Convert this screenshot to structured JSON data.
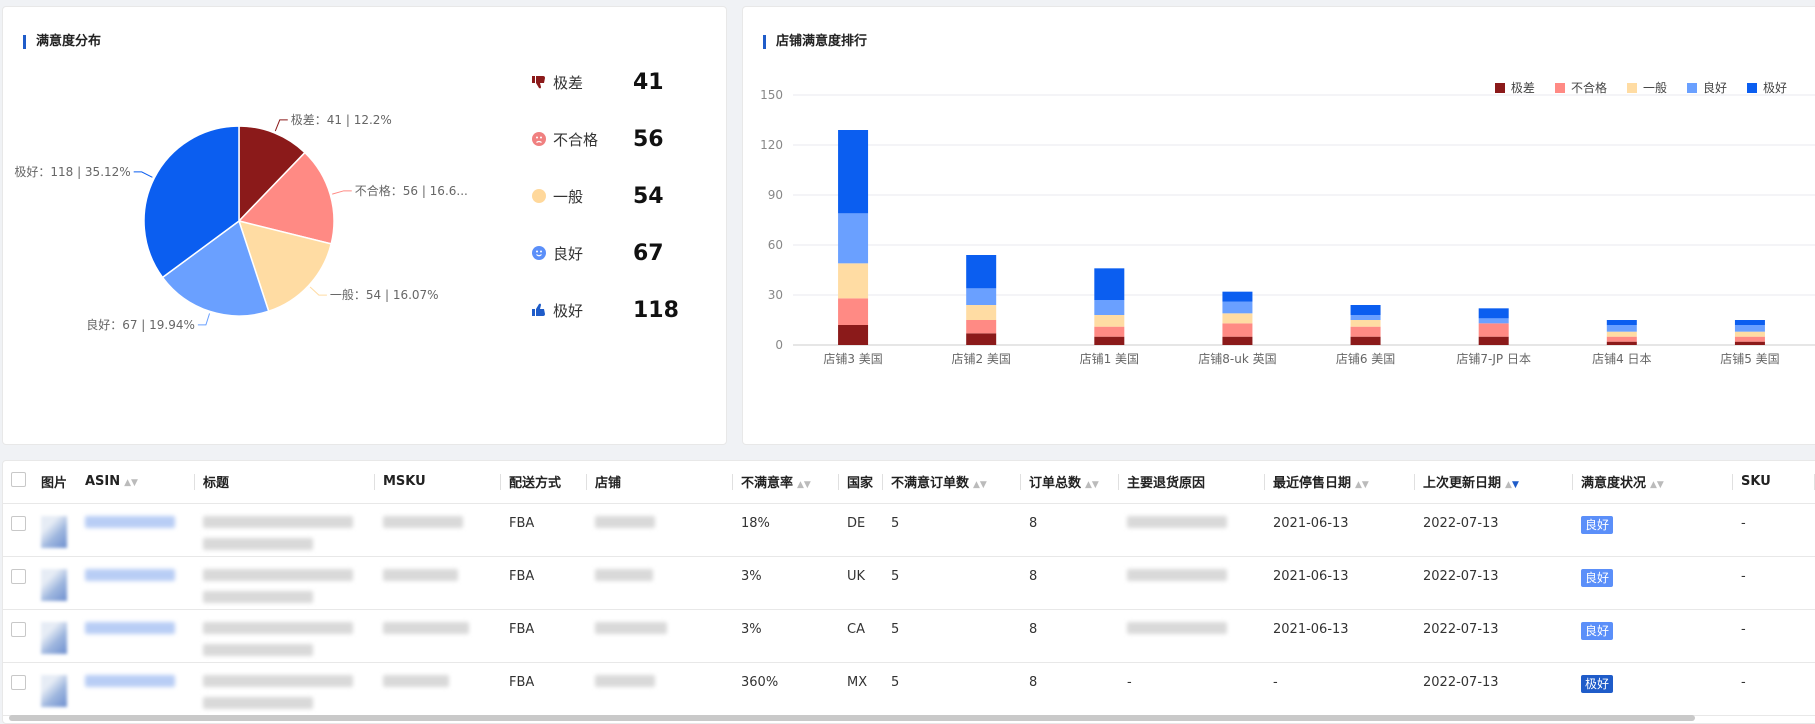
{
  "pie_panel": {
    "title": "满意度分布",
    "icon_colors": {
      "bad": "#8b1a1a",
      "neutral": "#f08080",
      "normal": "#ffd89b",
      "good": "#5b8ff9",
      "best": "#1f5cc9"
    },
    "legend": [
      {
        "label": "极差",
        "value": "41",
        "icon": "thumbs-down-icon",
        "color": "#8b1a1a"
      },
      {
        "label": "不合格",
        "value": "56",
        "icon": "sad-face-icon",
        "color": "#f08080"
      },
      {
        "label": "一般",
        "value": "54",
        "icon": "neutral-face-icon",
        "color": "#ffd89b"
      },
      {
        "label": "良好",
        "value": "67",
        "icon": "smile-face-icon",
        "color": "#5b8ff9"
      },
      {
        "label": "极好",
        "value": "118",
        "icon": "thumbs-up-icon",
        "color": "#1f5cc9"
      }
    ]
  },
  "bar_panel": {
    "title": "店铺满意度排行"
  },
  "chart_data": [
    {
      "type": "pie",
      "categories": [
        "极差",
        "不合格",
        "一般",
        "良好",
        "极好"
      ],
      "values": [
        41,
        56,
        54,
        67,
        118
      ],
      "colors": [
        "#8b1a1a",
        "#ff8a84",
        "#ffdca3",
        "#6aa0ff",
        "#0b5ef0"
      ],
      "slice_labels": [
        "极差：41 | 12.2%",
        "不合格：56 | 16.6...",
        "一般：54 | 16.07%",
        "良好：67 | 19.94%",
        "极好：118 | 35.12%"
      ]
    },
    {
      "type": "bar",
      "stacked": true,
      "categories": [
        "店铺3 美国",
        "店铺2 美国",
        "店铺1 美国",
        "店铺8-uk 英国",
        "店铺6 美国",
        "店铺7-JP 日本",
        "店铺4 日本",
        "店铺5 美国"
      ],
      "series": [
        {
          "name": "极差",
          "color": "#8b1a1a",
          "values": [
            12,
            7,
            5,
            5,
            5,
            5,
            2,
            2
          ]
        },
        {
          "name": "不合格",
          "color": "#ff8a84",
          "values": [
            16,
            8,
            6,
            8,
            6,
            8,
            3,
            3
          ]
        },
        {
          "name": "一般",
          "color": "#ffdca3",
          "values": [
            21,
            9,
            7,
            6,
            4,
            0,
            3,
            3
          ]
        },
        {
          "name": "良好",
          "color": "#6aa0ff",
          "values": [
            30,
            10,
            9,
            7,
            3,
            3,
            4,
            4
          ]
        },
        {
          "name": "极好",
          "color": "#0b5ef0",
          "values": [
            50,
            20,
            19,
            6,
            6,
            6,
            3,
            3
          ]
        }
      ],
      "ylim": [
        0,
        150
      ],
      "yticks": [
        0,
        30,
        60,
        90,
        120,
        150
      ],
      "grid": true,
      "legend_position": "top-right"
    }
  ],
  "table": {
    "headers": [
      "图片",
      "ASIN",
      "标题",
      "MSKU",
      "配送方式",
      "店铺",
      "不满意率",
      "国家",
      "不满意订单数",
      "订单总数",
      "主要退货原因",
      "最近停售日期",
      "上次更新日期",
      "满意度状况",
      "SKU"
    ],
    "rows": [
      {
        "shipping": "FBA",
        "rate": "18%",
        "country": "DE",
        "bad_orders": "5",
        "total_orders": "8",
        "reason": "",
        "stop_date": "2021-06-13",
        "update_date": "2022-07-13",
        "status": "良好",
        "status_color": "#5b8ff9",
        "sku": "-"
      },
      {
        "shipping": "FBA",
        "rate": "3%",
        "country": "UK",
        "bad_orders": "5",
        "total_orders": "8",
        "reason": "",
        "stop_date": "2021-06-13",
        "update_date": "2022-07-13",
        "status": "良好",
        "status_color": "#5b8ff9",
        "sku": "-"
      },
      {
        "shipping": "FBA",
        "rate": "3%",
        "country": "CA",
        "bad_orders": "5",
        "total_orders": "8",
        "reason": "",
        "stop_date": "2021-06-13",
        "update_date": "2022-07-13",
        "status": "良好",
        "status_color": "#5b8ff9",
        "sku": "-"
      },
      {
        "shipping": "FBA",
        "rate": "360%",
        "country": "MX",
        "bad_orders": "5",
        "total_orders": "8",
        "reason": "-",
        "stop_date": "-",
        "update_date": "2022-07-13",
        "status": "极好",
        "status_color": "#1f5cc9",
        "sku": "-"
      }
    ]
  }
}
